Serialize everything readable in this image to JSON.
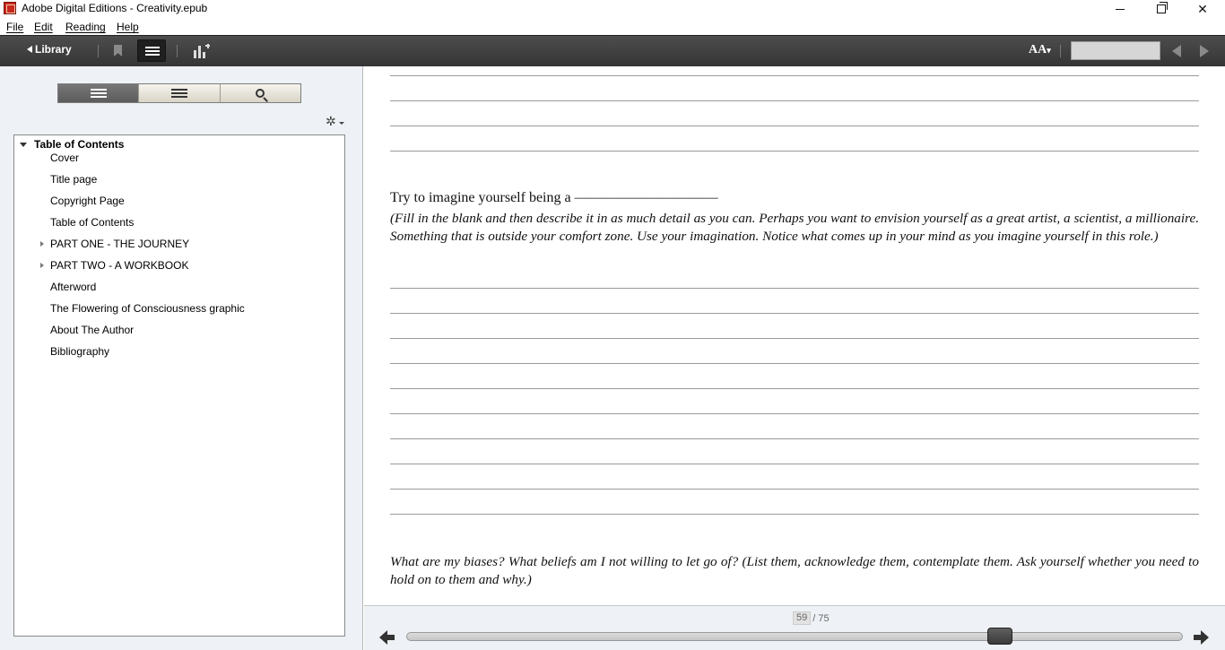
{
  "window": {
    "title": "Adobe Digital Editions - Creativity.epub",
    "minimize_icon": "minimize-icon",
    "maximize_icon": "restore-icon",
    "close_glyph": "✕"
  },
  "menu": {
    "items": [
      "File",
      "Edit",
      "Reading",
      "Help"
    ]
  },
  "toolbar": {
    "library_label": "Library",
    "font_label": "AA",
    "search_value": "",
    "icons": [
      "back-triangle-icon",
      "bookmark-icon",
      "toc-list-icon",
      "reading-stats-icon",
      "font-size-icon",
      "prev-page-icon",
      "next-page-icon"
    ]
  },
  "sidebar": {
    "tabs": [
      {
        "icon": "toc-list-icon",
        "active": true
      },
      {
        "icon": "bookmarks-list-icon",
        "active": false
      },
      {
        "icon": "search-icon",
        "active": false
      }
    ],
    "gear_glyph": "✲",
    "toc": {
      "header": "Table of Contents",
      "items": [
        {
          "label": "Cover",
          "expandable": false
        },
        {
          "label": "Title page",
          "expandable": false
        },
        {
          "label": "Copyright Page",
          "expandable": false
        },
        {
          "label": "Table of Contents",
          "expandable": false
        },
        {
          "label": "PART ONE - THE JOURNEY",
          "expandable": true
        },
        {
          "label": "PART TWO - A WORKBOOK",
          "expandable": true
        },
        {
          "label": "Afterword",
          "expandable": false
        },
        {
          "label": "The Flowering of Consciousness graphic",
          "expandable": false
        },
        {
          "label": "About The Author",
          "expandable": false
        },
        {
          "label": "Bibliography",
          "expandable": false
        }
      ]
    }
  },
  "reader": {
    "prompt": "Try to imagine yourself being a ——————————",
    "instruction": "(Fill in the blank and then describe it in as much detail as you can. Perhaps you want to envision yourself as a great artist, a scientist, a millionaire. Something that is outside your comfort zone. Use your imagination. Notice what comes up in your mind as you imagine yourself in this role.)",
    "question": "What are my biases? What beliefs am I not willing to let go of? (List them, acknowledge them, contemplate them. Ask yourself whether you need to hold on to them and why.)"
  },
  "pagination": {
    "current": "59",
    "separator_total": "/ 75",
    "progress": 0.773
  },
  "colors": {
    "toolbar": "#3f3f3f",
    "sidebar_bg": "#eef1f5",
    "app_icon": "#c8281e"
  }
}
